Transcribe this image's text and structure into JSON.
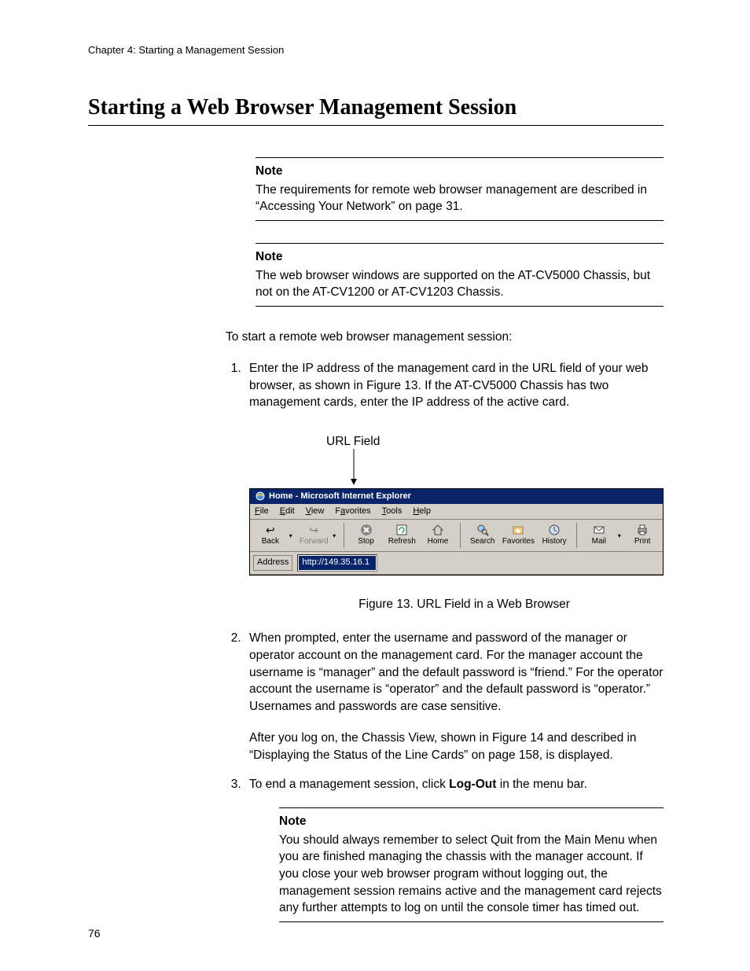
{
  "header": {
    "chapter_line": "Chapter 4: Starting a Management Session"
  },
  "title": "Starting a Web Browser Management Session",
  "notes": {
    "label": "Note",
    "n1": "The requirements for remote web browser management are described in “Accessing Your Network” on page 31.",
    "n2": "The web browser windows are supported on the AT-CV5000 Chassis, but not on the AT-CV1200 or AT-CV1203 Chassis.",
    "n3": "You should always remember to select Quit from the Main Menu when you are finished managing the chassis with the manager account. If you close your web browser program without logging out, the management session remains active and the management card rejects any further attempts to log on until the console timer has timed out."
  },
  "intro": "To start a remote web browser management session:",
  "steps": {
    "s1": "Enter the IP address of the management card in the URL field of your web browser, as shown in Figure 13. If the AT-CV5000 Chassis has two management cards, enter the IP address of the active card.",
    "s2": "When prompted, enter the username and password of the manager or operator account on the management card. For the manager account the username is “manager” and the default password is “friend.” For the operator account the username is “operator” and the default password is “operator.” Usernames and passwords are case sensitive.",
    "s2b": "After you log on, the Chassis View, shown in Figure 14 and described in “Displaying the Status of the Line Cards” on page 158, is displayed.",
    "s3_pre": "To end a management session, click ",
    "s3_bold": "Log-Out",
    "s3_post": " in the menu bar."
  },
  "figure": {
    "url_field_label": "URL Field",
    "caption": "Figure 13. URL Field in a Web Browser",
    "ie": {
      "title": "Home - Microsoft Internet Explorer",
      "menus": {
        "file": "File",
        "edit": "Edit",
        "view": "View",
        "favorites": "Favorites",
        "tools": "Tools",
        "help": "Help"
      },
      "toolbar": {
        "back": "Back",
        "forward": "Forward",
        "stop": "Stop",
        "refresh": "Refresh",
        "home": "Home",
        "search": "Search",
        "favorites": "Favorites",
        "history": "History",
        "mail": "Mail",
        "print": "Print"
      },
      "address_label": "Address",
      "address_value": "http://149.35.16.1"
    }
  },
  "page_number": "76"
}
